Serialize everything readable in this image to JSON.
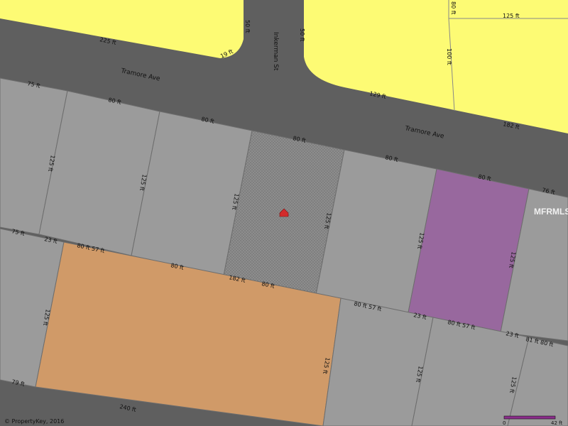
{
  "colors": {
    "road": "#5f5f5f",
    "residential_lot": "#9b9b9b",
    "yellow_zone": "#fdfb74",
    "orange_lot": "#d09a68",
    "purple_lot": "#98689e",
    "subject_lot": "#8a8a8a",
    "subject_marker": "#d32c2c",
    "scale_bar": "#8b2d8b"
  },
  "streets": {
    "tramore_ave_west": "Tramore Ave",
    "tramore_ave_east": "Tramore Ave",
    "inkerman_st": "Inkerman St"
  },
  "dimensions": {
    "d_225": "225 ft",
    "d_19": "19 ft",
    "d_50a": "50 ft",
    "d_50b": "50 ft",
    "d_80_top": "80 ft",
    "d_125_top": "125 ft",
    "d_100": "100 ft",
    "d_129": "129 ft",
    "d_182_top": "182 ft",
    "d_75_left": "75 ft",
    "d_80_a": "80 ft",
    "d_80_b": "80 ft",
    "d_80_c": "80 ft",
    "d_80_d": "80 ft",
    "d_80_e": "80 ft",
    "d_76_right": "76 ft",
    "d_125_a": "125 ft",
    "d_125_b": "125 ft",
    "d_125_c": "125 ft",
    "d_125_d": "125 ft",
    "d_125_e": "125 ft",
    "d_125_f": "125 ft",
    "d_75_mid": "75 ft",
    "d_23_a": "23 ft",
    "d_80_57_a": "80 ft 57 ft",
    "d_80_f": "80 ft",
    "d_182_mid": "182 ft",
    "d_80_g": "80 ft",
    "d_80_57_b": "80 ft 57 ft",
    "d_23_b": "23 ft",
    "d_80_57_c": "80 ft 57 ft",
    "d_23_c": "23 ft",
    "d_81_80": "81 ft 80 ft",
    "d_125_g": "125 ft",
    "d_125_h": "125 ft",
    "d_125_i": "125 ft",
    "d_125_j": "125 ft",
    "d_79": "79 ft",
    "d_240": "240 ft"
  },
  "watermark": "MFRMLS",
  "copyright": "© PropertyKey, 2016",
  "scale": {
    "start": "0",
    "end": "42 ft"
  }
}
